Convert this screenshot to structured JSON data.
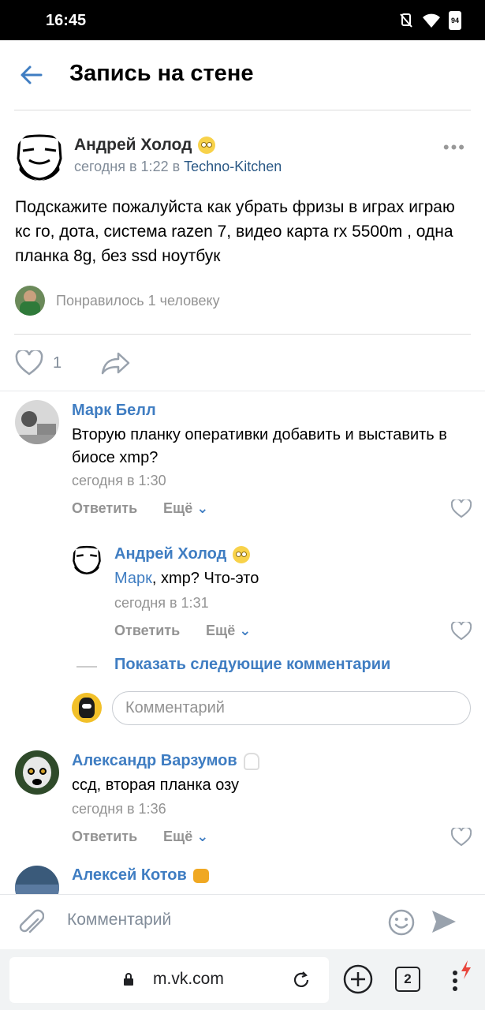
{
  "status": {
    "time": "16:45",
    "battery": "94"
  },
  "header": {
    "title": "Запись на стене"
  },
  "post": {
    "author": "Андрей Холод",
    "time": "сегодня в 1:22 в ",
    "group": "Techno-Kitchen",
    "text": "Подскажите пожалуйста как убрать фризы в играх играю кс го, дота, система razen 7, видео карта rx 5500m , одна планка 8g, без ssd ноутбук",
    "liked_by": "Понравилось 1 человеку",
    "like_count": "1"
  },
  "comments": [
    {
      "name": "Марк Белл",
      "text": "Вторую планку оперативки добавить и выставить в биосе xmp?",
      "time": "сегодня в 1:30",
      "reply": "Ответить",
      "more": "Ещё"
    },
    {
      "name": "Андрей Холод",
      "mention": "Марк",
      "text": ", xmp? Что-это",
      "time": "сегодня в 1:31",
      "reply": "Ответить",
      "more": "Ещё"
    },
    {
      "name": "Александр Варзумов",
      "text": "ссд, вторая планка озу",
      "time": "сегодня в 1:36",
      "reply": "Ответить",
      "more": "Ещё"
    },
    {
      "name": "Алексей Котов"
    }
  ],
  "show_more": "Показать следующие комментарии",
  "reply_placeholder": "Комментарий",
  "compose_placeholder": "Комментарий",
  "browser": {
    "url": "m.vk.com",
    "tabs": "2"
  },
  "colors": {
    "link": "#3f7dc2",
    "meta": "#939393"
  }
}
